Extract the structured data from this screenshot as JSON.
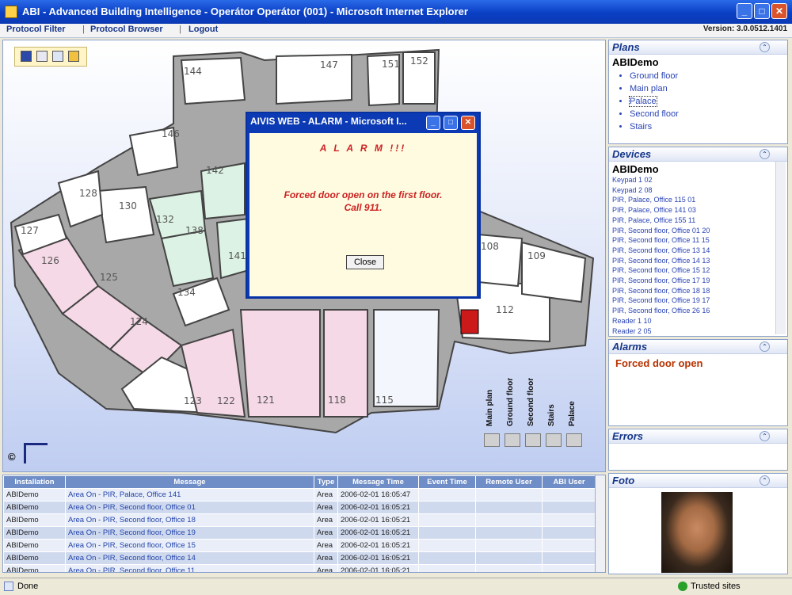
{
  "window": {
    "title": "ABI - Advanced Building Intelligence - Operátor Operátor (001) - Microsoft Internet Explorer"
  },
  "menu": {
    "items": [
      "Protocol Filter",
      "Protocol Browser",
      "Logout"
    ],
    "version": "Version: 3.0.0512.1401"
  },
  "map": {
    "room_numbers": [
      "144",
      "147",
      "151",
      "152",
      "146",
      "142",
      "128",
      "130",
      "132",
      "138",
      "127",
      "126",
      "125",
      "141",
      "134",
      "124",
      "123",
      "122",
      "121",
      "118",
      "115",
      "112",
      "108",
      "109"
    ],
    "nav": [
      "Main plan",
      "Ground floor",
      "Second floor",
      "Stairs",
      "Palace"
    ],
    "copyright": "©"
  },
  "alarm_dialog": {
    "title": "AIVIS WEB - ALARM - Microsoft I...",
    "header": "A L A R M !!!",
    "message_line1": "Forced door open on the first floor.",
    "message_line2": "Call 911.",
    "close_label": "Close"
  },
  "log_table": {
    "columns": [
      "Installation",
      "Message",
      "Type",
      "Message Time",
      "Event Time",
      "Remote User",
      "ABI User"
    ],
    "rows": [
      [
        "ABIDemo",
        "Area On - PIR, Palace, Office 141",
        "Area",
        "2006-02-01 16:05:47",
        "",
        "",
        ""
      ],
      [
        "ABIDemo",
        "Area On - PIR, Second floor, Office 01",
        "Area",
        "2006-02-01 16:05:21",
        "",
        "",
        ""
      ],
      [
        "ABIDemo",
        "Area On - PIR, Second floor, Office 18",
        "Area",
        "2006-02-01 16:05:21",
        "",
        "",
        ""
      ],
      [
        "ABIDemo",
        "Area On - PIR, Second floor, Office 19",
        "Area",
        "2006-02-01 16:05:21",
        "",
        "",
        ""
      ],
      [
        "ABIDemo",
        "Area On - PIR, Second floor, Office 15",
        "Area",
        "2006-02-01 16:05:21",
        "",
        "",
        ""
      ],
      [
        "ABIDemo",
        "Area On - PIR, Second floor, Office 14",
        "Area",
        "2006-02-01 16:05:21",
        "",
        "",
        ""
      ],
      [
        "ABIDemo",
        "Area On - PIR, Second floor, Office 11",
        "Area",
        "2006-02-01 16:05:21",
        "",
        "",
        ""
      ]
    ]
  },
  "plans": {
    "title": "Plans",
    "group": "ABIDemo",
    "items": [
      "Ground floor",
      "Main plan",
      "Palace",
      "Second floor",
      "Stairs"
    ],
    "selected": "Palace"
  },
  "devices": {
    "title": "Devices",
    "group": "ABIDemo",
    "items": [
      "Keypad 1 02",
      "Keypad 2 08",
      "PIR, Palace, Office 115 01",
      "PIR, Palace, Office 141 03",
      "PIR, Palace, Office 155 11",
      "PIR, Second floor, Office 01 20",
      "PIR, Second floor, Office 11 15",
      "PIR, Second floor, Office 13 14",
      "PIR, Second floor, Office 14 13",
      "PIR, Second floor, Office 15 12",
      "PIR, Second floor, Office 17 19",
      "PIR, Second floor, Office 18 18",
      "PIR, Second floor, Office 19 17",
      "PIR, Second floor, Office 26 16",
      "Reader 1 10",
      "Reader 2 05"
    ]
  },
  "alarms": {
    "title": "Alarms",
    "text": "Forced door open"
  },
  "errors": {
    "title": "Errors"
  },
  "foto": {
    "title": "Foto"
  },
  "status": {
    "left": "Done",
    "zone": "Trusted sites"
  }
}
